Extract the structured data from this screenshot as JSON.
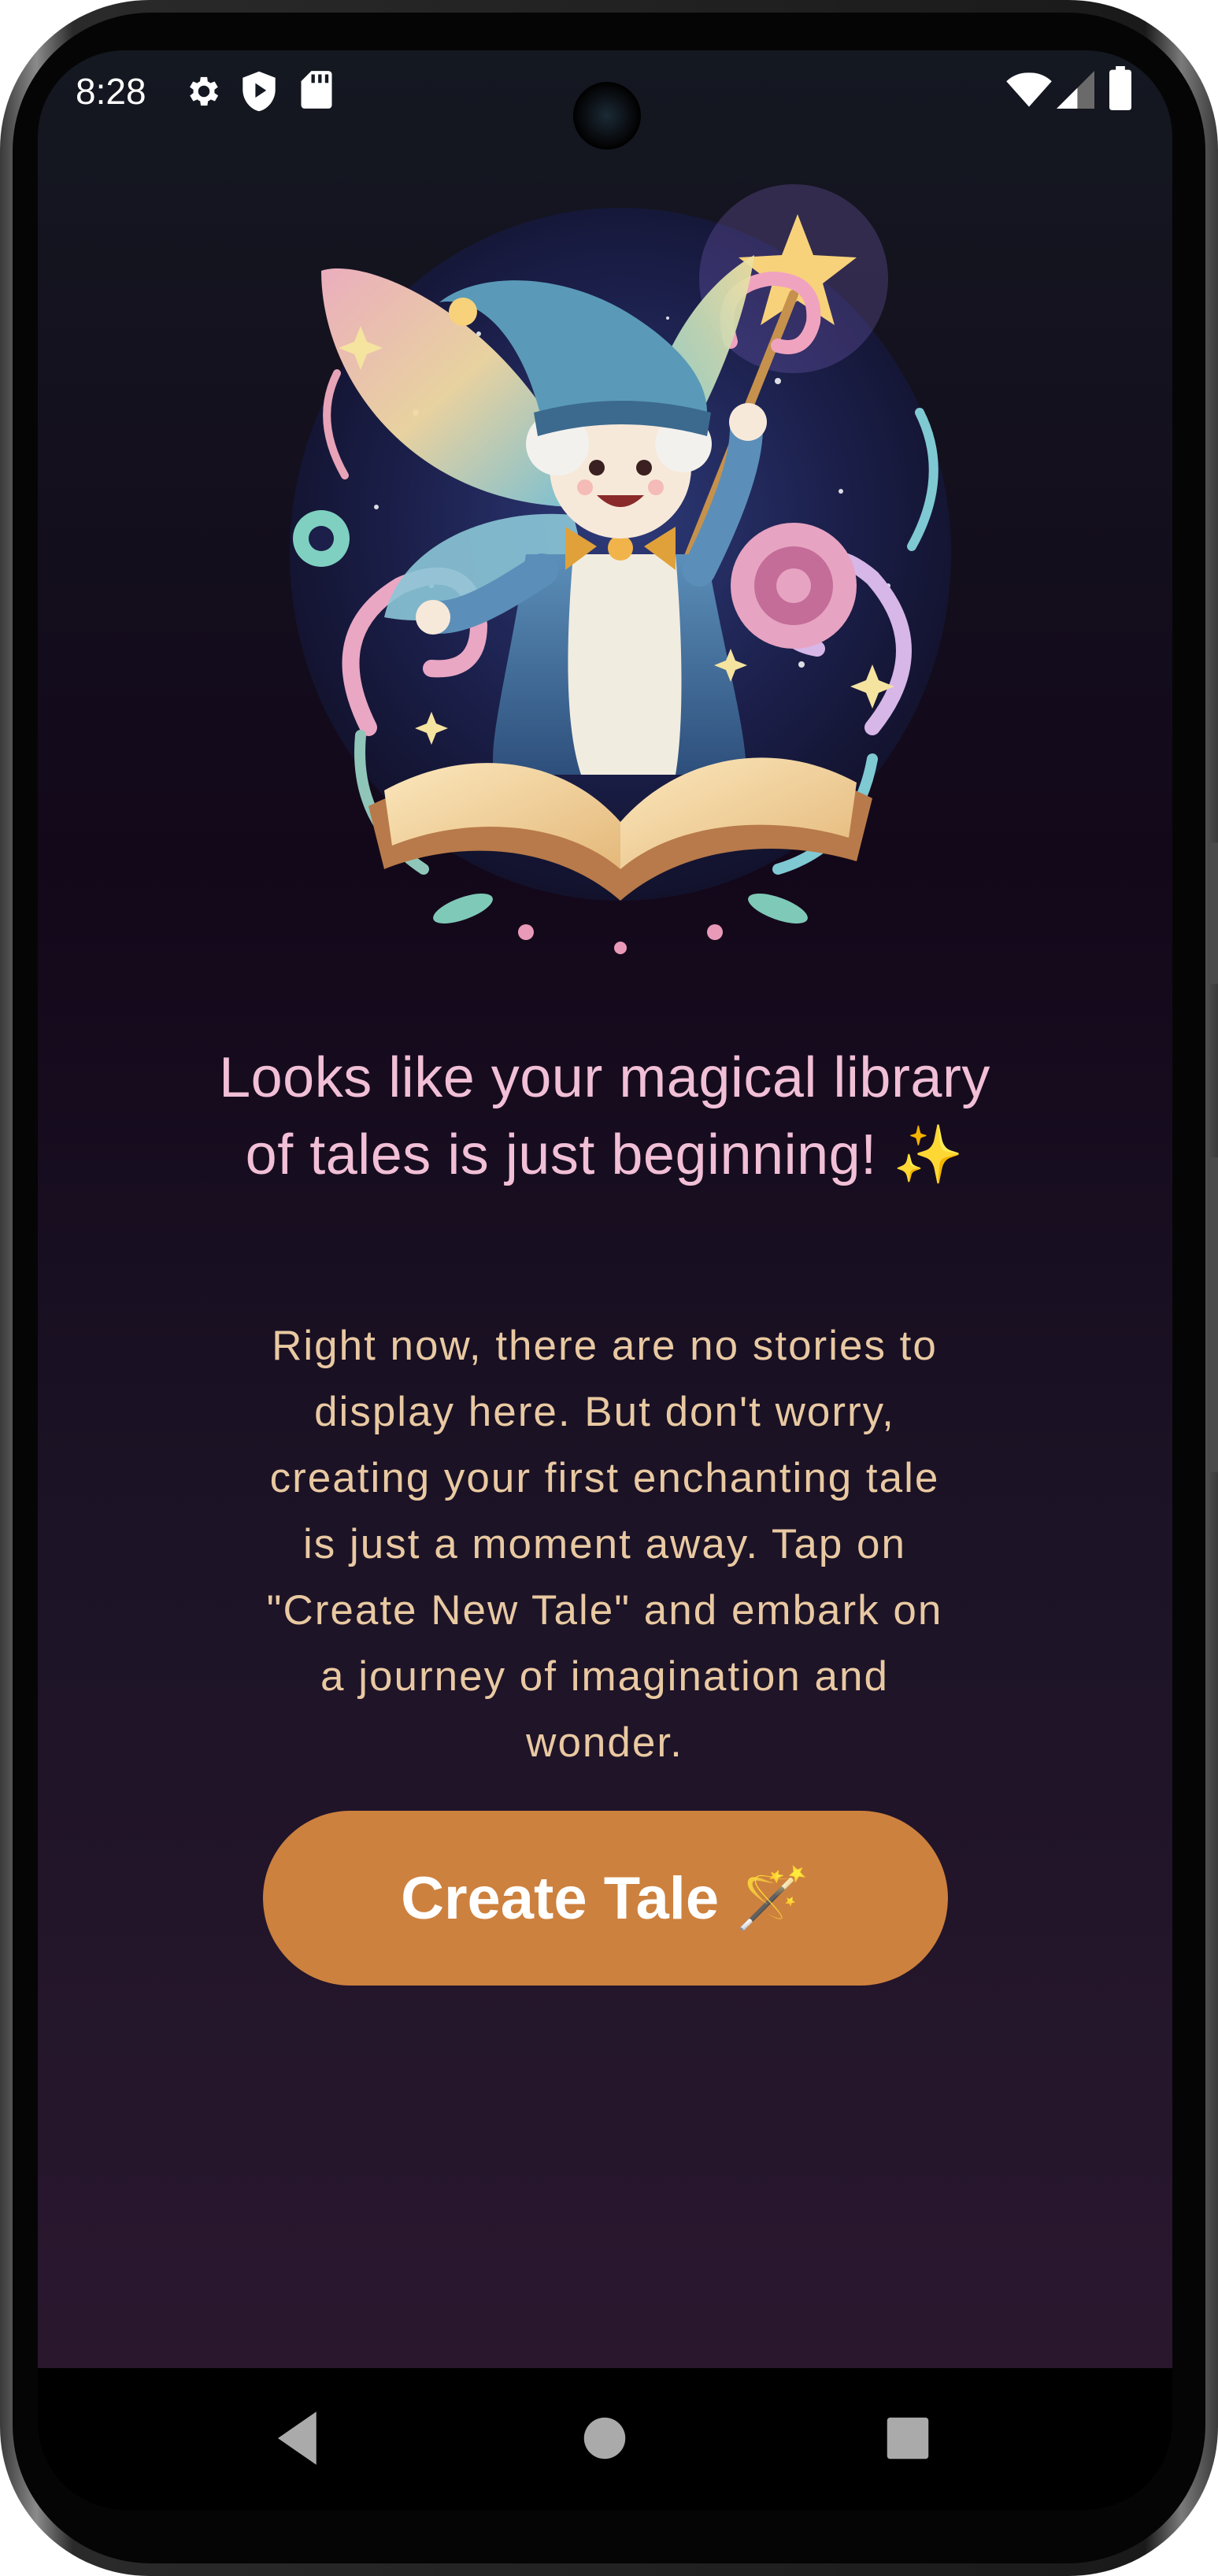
{
  "status_bar": {
    "time": "8:28",
    "left_icons": [
      "gear-icon",
      "shield-icon",
      "sd-card-icon"
    ],
    "right_icons": [
      "wifi-icon",
      "signal-icon",
      "battery-icon"
    ]
  },
  "empty_state": {
    "illustration": "wizard-fairy-with-open-book",
    "headline": "Looks like your magical library of tales is just beginning! ✨",
    "body": "Right now, there are no stories to display here. But don't worry, creating your first enchanting tale is just a moment away. Tap on \"Create New Tale\" and embark on a journey of imagination and wonder.",
    "button_label": "Create Tale 🪄"
  },
  "nav_bar": {
    "buttons": [
      "back-icon",
      "home-icon",
      "recents-icon"
    ]
  },
  "colors": {
    "headline": "#f1bfd6",
    "body": "#e9c9a2",
    "button": "#cd813e",
    "background_top": "#141821",
    "background_bottom": "#2c1830"
  }
}
